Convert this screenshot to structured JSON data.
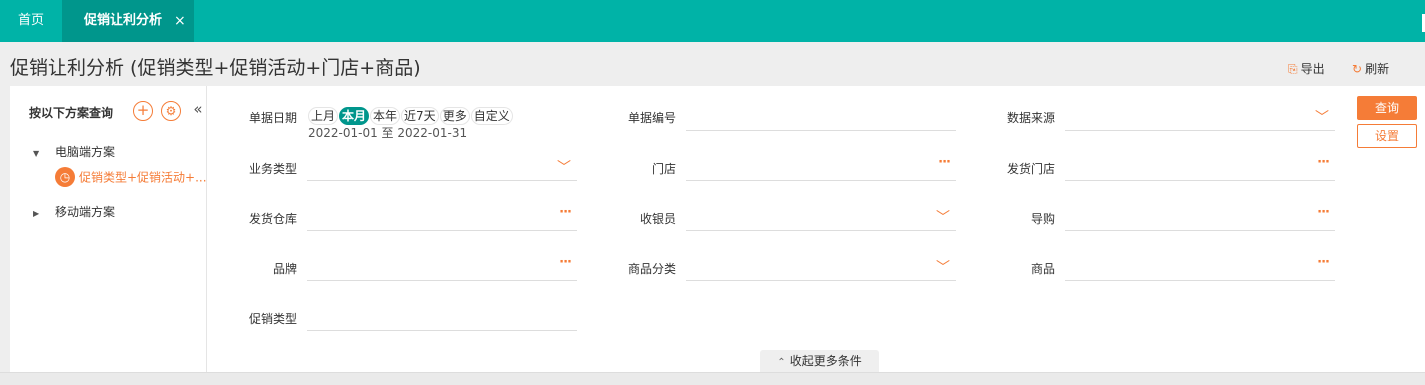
{
  "tabs": {
    "home": "首页",
    "active": "促销让利分析",
    "close": "×"
  },
  "page": {
    "title": "促销让利分析 (促销类型+促销活动+门店+商品)",
    "export": "导出",
    "refresh": "刷新"
  },
  "left": {
    "title": "按以下方案查询",
    "add_symbol": "+",
    "collapse_symbol": "«",
    "tree": {
      "pc": "电脑端方案",
      "plan": "促销类型+促销活动+...",
      "mobile": "移动端方案"
    }
  },
  "form": {
    "date_label": "单据日期",
    "date_options": [
      "上月",
      "本月",
      "本年",
      "近7天",
      "更多",
      "自定义"
    ],
    "date_selected": "本月",
    "date_range": "2022-01-01 至 2022-01-31",
    "doc_no_label": "单据编号",
    "source_label": "数据来源",
    "biz_type_label": "业务类型",
    "store_label": "门店",
    "ship_store_label": "发货门店",
    "warehouse_label": "发货仓库",
    "cashier_label": "收银员",
    "guide_label": "导购",
    "brand_label": "品牌",
    "category_label": "商品分类",
    "product_label": "商品",
    "promo_type_label": "促销类型",
    "dots": "···"
  },
  "actions": {
    "query": "查询",
    "settings": "设置",
    "collapse_more": "收起更多条件"
  },
  "colors": {
    "tabbar": "#00b3a7",
    "tab_active": "#00968c",
    "accent": "#f57c37"
  }
}
